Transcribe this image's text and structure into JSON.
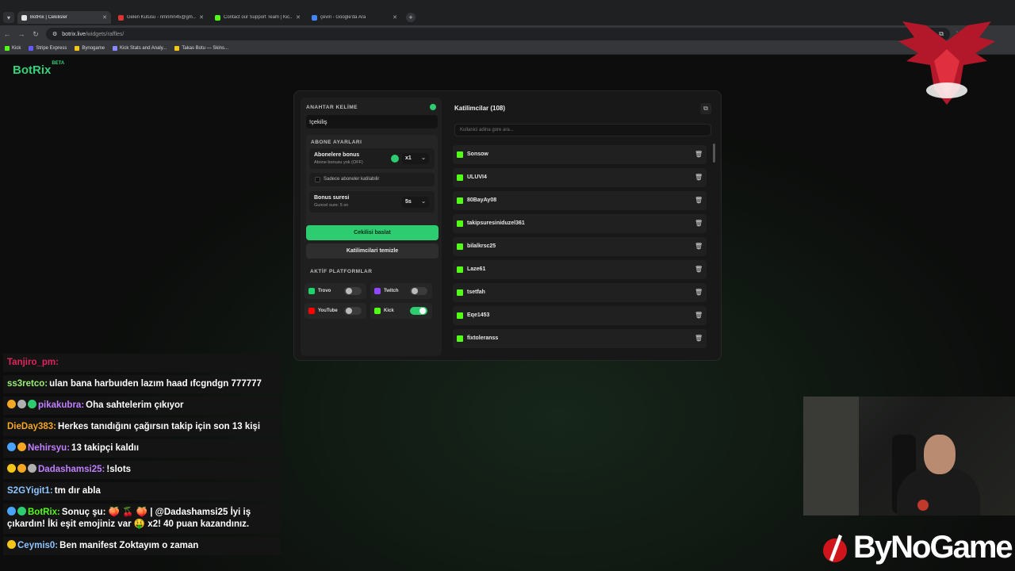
{
  "browser": {
    "tabs": [
      {
        "label": "BotRix | Cekilisler",
        "active": true,
        "favicon_color": "#e5e5e5"
      },
      {
        "label": "Gelen Kutusu - nmnmn45@gm...",
        "active": false,
        "favicon_color": "#d33"
      },
      {
        "label": "Contact our Support Team | Kic...",
        "active": false,
        "favicon_color": "#53fc18"
      },
      {
        "label": "çeviri - Google'da Ara",
        "active": false,
        "favicon_color": "#4285f4"
      }
    ],
    "url_host": "botrix.live",
    "url_path": "/widgets/raffles/",
    "bookmarks": [
      "Kick",
      "Stripe Express",
      "Bynogame",
      "Kick Stats and Analy...",
      "Takas Botu — Skins..."
    ]
  },
  "brand": {
    "name": "BotRix",
    "badge": "BETA"
  },
  "keyword": {
    "title": "ANAHTAR KELİME",
    "value": "!çekiliş"
  },
  "subscriber": {
    "title": "ABONE AYARLARI",
    "bonus_title": "Abonelere bonus",
    "bonus_sub": "Abone bonusu yok (OFF)",
    "bonus_value": "x1",
    "only_subs_label": "Sadece aboneler katilabilir",
    "duration_title": "Bonus suresi",
    "duration_sub": "Guncel sure: 5 sn",
    "duration_value": "5s"
  },
  "buttons": {
    "start": "Cekilisi baslat",
    "clear": "Katilimcilari temizle"
  },
  "platforms": {
    "title": "AKTİF PLATFORMLAR",
    "items": [
      {
        "label": "Trovo",
        "on": false,
        "color": "#19d66b"
      },
      {
        "label": "Twitch",
        "on": false,
        "color": "#9146ff"
      },
      {
        "label": "YouTube",
        "on": false,
        "color": "#ff0000"
      },
      {
        "label": "Kick",
        "on": true,
        "color": "#53fc18"
      }
    ]
  },
  "participants": {
    "title": "Katilimcilar (108)",
    "search_placeholder": "Kullanici adina gore ara...",
    "names": [
      "Sonsow",
      "ULUVI4",
      "80BayAy08",
      "takipsuresiniduzel361",
      "bilalkrsc25",
      "Laze61",
      "tsetfah",
      "Eqe1453",
      "fixtoleranss"
    ]
  },
  "chat": [
    {
      "user": "Tanjiro_pm:",
      "text": "",
      "color": "#e0245e",
      "prefix": []
    },
    {
      "user": "ss3retco:",
      "text": "ulan bana harbuıden lazım haad ıfcgndgn 777777",
      "color": "#9aef73",
      "prefix": []
    },
    {
      "user": "pikakubra:",
      "text": "Oha sahtelerim çıkıyor",
      "color": "#c080ff",
      "prefix": [
        "#f5a623",
        "#b0b0b0",
        "#2ecc71"
      ]
    },
    {
      "user": "DieDay383:",
      "text": "Herkes tanıdığını çağırsın takip için son 13 kişi",
      "color": "#f5a623",
      "prefix": []
    },
    {
      "user": "Nehirsyu:",
      "text": "13 takipçi kaldıı",
      "color": "#c080ff",
      "prefix": [
        "#4aa3ff",
        "#f5a623"
      ]
    },
    {
      "user": "Dadashamsi25:",
      "text": "!slots",
      "color": "#c080ff",
      "prefix": [
        "#f5c518",
        "#f5a623",
        "#b0b0b0"
      ]
    },
    {
      "user": "S2GYigit1:",
      "text": "tm dır abla",
      "color": "#8ec5ff",
      "prefix": []
    },
    {
      "user": "BotRix:",
      "text": "Sonuç şu: 🍑 🍒 🍑 | @Dadashamsi25 İyi iş çıkardın! İki eşit emojiniz var 🤑 x2! 40 puan kazandınız.",
      "color": "#53fc18",
      "prefix": [
        "#4aa3ff",
        "#2ecc71"
      ]
    },
    {
      "user": "Ceymis0:",
      "text": "Ben manifest Zoktayım o zaman",
      "color": "#8ec5ff",
      "prefix": [
        "#f5c518"
      ]
    }
  ],
  "overlay": {
    "sponsor": "ByNoGame",
    "logo": "TDL"
  },
  "colors": {
    "accent": "#2ecc71",
    "kick_green": "#53fc18"
  }
}
